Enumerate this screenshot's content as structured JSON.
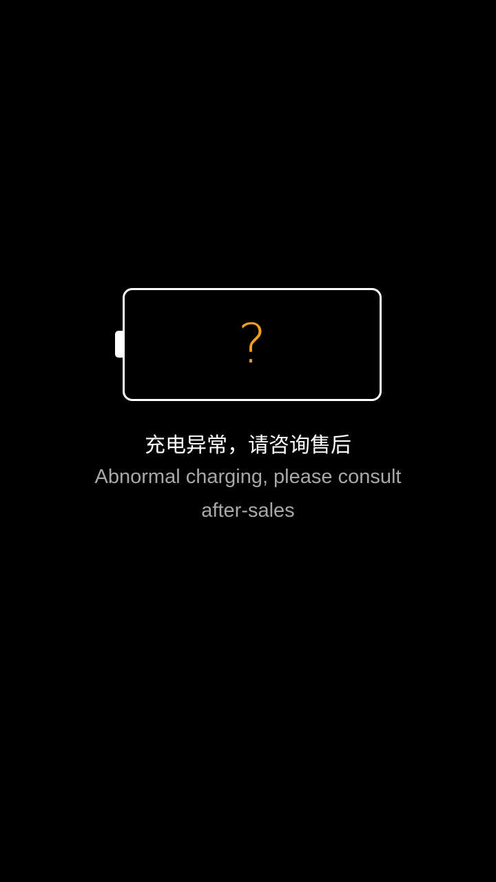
{
  "battery": {
    "status_symbol": "?",
    "symbol_color": "#f5a019",
    "outline_color": "#ffffff"
  },
  "message": {
    "primary_zh": "充电异常，请咨询售后",
    "secondary_en": "Abnormal charging, please consult after-sales"
  },
  "colors": {
    "background": "#000000",
    "primary_text": "#ffffff",
    "secondary_text": "#a8a8a8"
  }
}
